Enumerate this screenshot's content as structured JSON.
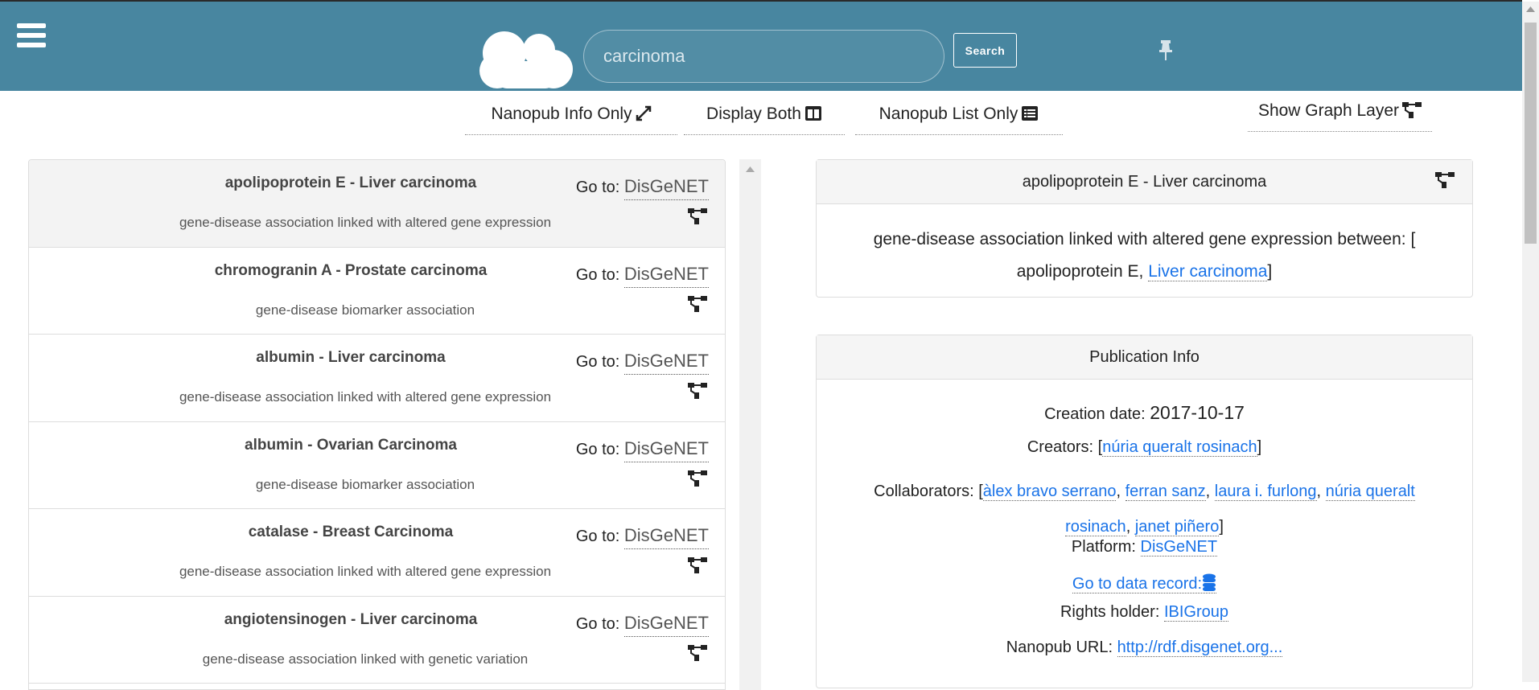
{
  "header": {
    "search_value": "carcinoma",
    "search_button": "Search",
    "bg_color": "#4886a0"
  },
  "toolbar": {
    "info_only": "Nanopub Info Only",
    "both": "Display Both",
    "list_only": "Nanopub List Only",
    "graph_layer": "Show Graph Layer"
  },
  "list": {
    "goto_label": "Go to:",
    "items": [
      {
        "title": "apolipoprotein E - Liver carcinoma",
        "subtitle": "gene-disease association linked with altered gene expression",
        "link": "DisGeNET"
      },
      {
        "title": "chromogranin A - Prostate carcinoma",
        "subtitle": "gene-disease biomarker association",
        "link": "DisGeNET"
      },
      {
        "title": "albumin - Liver carcinoma",
        "subtitle": "gene-disease association linked with altered gene expression",
        "link": "DisGeNET"
      },
      {
        "title": "albumin - Ovarian Carcinoma",
        "subtitle": "gene-disease biomarker association",
        "link": "DisGeNET"
      },
      {
        "title": "catalase - Breast Carcinoma",
        "subtitle": "gene-disease association linked with altered gene expression",
        "link": "DisGeNET"
      },
      {
        "title": "angiotensinogen - Liver carcinoma",
        "subtitle": "gene-disease association linked with genetic variation",
        "link": "DisGeNET"
      }
    ]
  },
  "detail": {
    "title": "apolipoprotein E - Liver carcinoma",
    "text": "gene-disease association linked with altered gene expression between: [",
    "entity1": "apolipoprotein E,",
    "entity2": "Liver carcinoma",
    "close": "]"
  },
  "publication": {
    "title": "Publication Info",
    "creation_label": "Creation date:",
    "creation_value": "2017-10-17",
    "creators_label": "Creators:",
    "creators": [
      "núria queralt rosinach"
    ],
    "collaborators_label": "Collaborators:",
    "collaborators": [
      "àlex bravo serrano",
      "ferran sanz",
      "laura i. furlong",
      "núria queralt rosinach",
      "janet piñero"
    ],
    "platform_label": "Platform:",
    "platform": "DisGeNET",
    "data_record": "Go to data record:",
    "rights_label": "Rights holder:",
    "rights": "IBIGroup",
    "url_label": "Nanopub URL:",
    "url": "http://rdf.disgenet.org..."
  }
}
